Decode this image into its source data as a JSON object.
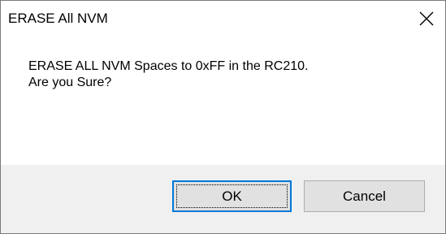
{
  "window": {
    "title": "ERASE All NVM",
    "close_icon": "close-icon"
  },
  "message": {
    "line1": "ERASE ALL NVM Spaces to 0xFF in the RC210.",
    "line2": "Are you Sure?"
  },
  "buttons": {
    "ok_label": "OK",
    "cancel_label": "Cancel"
  },
  "colors": {
    "footer_bg": "#f0f0f0",
    "button_bg": "#e1e1e1",
    "focus_border": "#0078d7"
  }
}
